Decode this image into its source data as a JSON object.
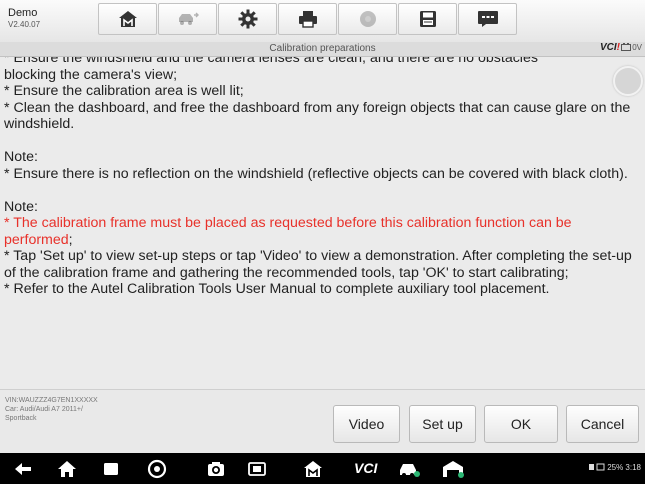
{
  "app": {
    "name": "Demo",
    "version": "V2.40.07"
  },
  "toolbar": {
    "buttons": [
      {
        "icon": "home-icon"
      },
      {
        "icon": "vehicle-swap-icon"
      },
      {
        "icon": "settings-icon"
      },
      {
        "icon": "print-icon"
      },
      {
        "icon": "help-icon"
      },
      {
        "icon": "save-icon"
      },
      {
        "icon": "message-icon"
      }
    ]
  },
  "titlebar": {
    "title": "Calibration preparations",
    "vci_text": "VCI",
    "battery_text": "0V"
  },
  "content": {
    "line0": "* Ensure the windshield and the camera lenses are clean, and there are no obstacles",
    "line1": "blocking the camera's view;",
    "line2": "* Ensure the calibration area is well lit;",
    "line3": "* Clean the dashboard, and free the dashboard from any foreign objects that can cause glare on the windshield.",
    "note1_label": "Note:",
    "note1_text": "* Ensure there is no reflection on the windshield (reflective objects can be covered with black cloth).",
    "note2_label": "Note:",
    "note2_red": "* The calibration frame must be placed as requested before this calibration function can be performed",
    "note2_red_tail": ";",
    "note2_text1": "* Tap 'Set up' to view set-up steps or tap 'Video' to view a demonstration. After completing the set-up of the calibration frame and gathering the recommended tools, tap 'OK' to start calibrating;",
    "note2_text2": "* Refer to the Autel Calibration Tools User Manual to complete auxiliary tool placement."
  },
  "vehicle_info": {
    "vin": "VIN:WAUZZZ4G7EN1XXXXX",
    "car": "Car: Audi/Audi A7 2011+/",
    "variant": "Sportback"
  },
  "buttons": {
    "video": "Video",
    "setup": "Set up",
    "ok": "OK",
    "cancel": "Cancel"
  },
  "navbar": {
    "vci_label": "VCI",
    "status_text": "25%  3:18"
  },
  "colors": {
    "warning_red": "#e8312a",
    "navbar_bg": "#000000"
  }
}
